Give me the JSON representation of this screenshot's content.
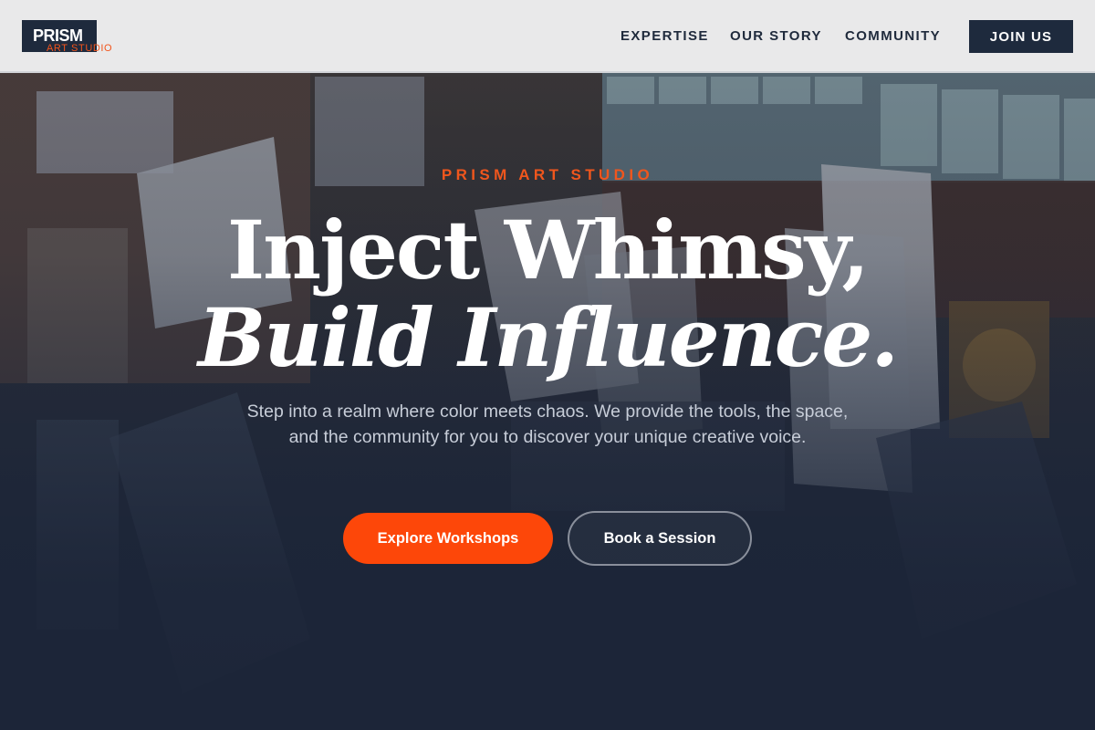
{
  "header": {
    "logo_name": "PRISM",
    "logo_tagline": "ART STUDIO",
    "nav": [
      {
        "label": "EXPERTISE"
      },
      {
        "label": "OUR STORY"
      },
      {
        "label": "COMMUNITY"
      }
    ],
    "cta_label": "JOIN US"
  },
  "hero": {
    "eyebrow": "PRISM ART STUDIO",
    "headline_line1": "Inject Whimsy,",
    "headline_line2": "Build Influence.",
    "subtext": "Step into a realm where color meets chaos. We provide the tools, the space, and the community for you to discover your unique creative voice.",
    "primary_button": "Explore Workshops",
    "secondary_button": "Book a Session"
  },
  "colors": {
    "accent": "#fd4709",
    "navy": "#1e2a3d",
    "header_bg": "#f0f0f1"
  }
}
